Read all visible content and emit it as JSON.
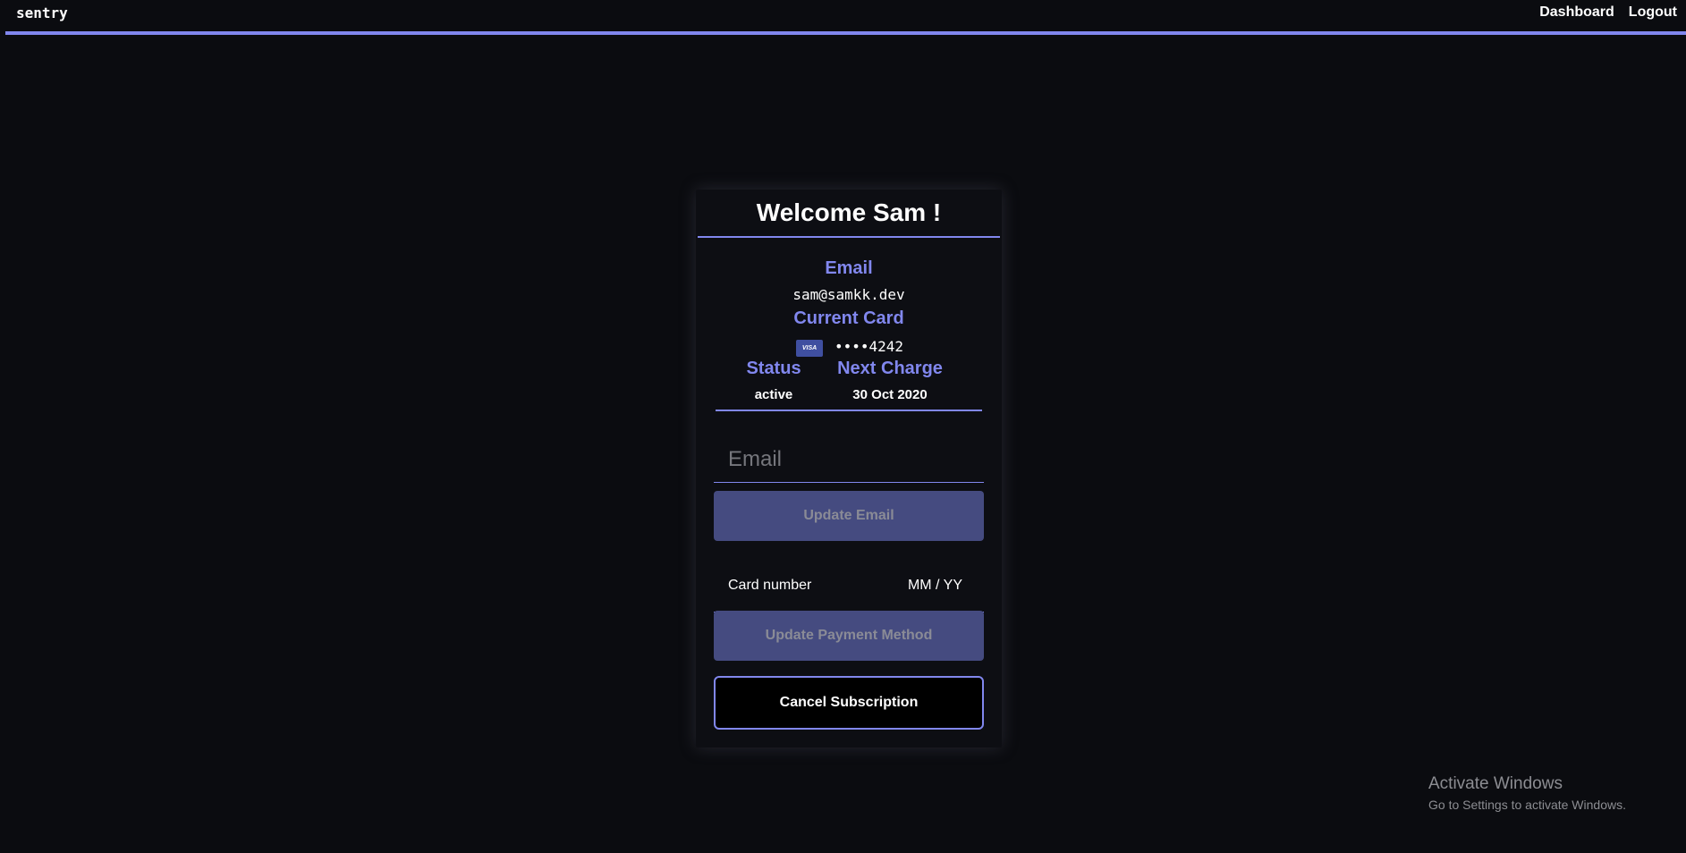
{
  "header": {
    "brand": "sentry",
    "nav": [
      "Dashboard",
      "Logout"
    ],
    "accent_color": "#8187ee"
  },
  "account": {
    "title": "Welcome Sam !",
    "email_label": "Email",
    "email_value": "sam@samkk.dev",
    "card_label": "Current Card",
    "card_brand": "VISA",
    "card_value": "••••4242",
    "status_label": "Status",
    "status_value": "active",
    "next_charge_label": "Next Charge",
    "next_charge_value": "30 Oct 2020"
  },
  "forms": {
    "email_placeholder": "Email",
    "update_email_label": "Update Email",
    "card_number_placeholder": "Card number",
    "card_expiry_placeholder": "MM / YY",
    "update_payment_label": "Update Payment Method",
    "cancel_label": "Cancel Subscription"
  },
  "watermark": {
    "title": "Activate Windows",
    "subtitle": "Go to Settings to activate Windows."
  }
}
